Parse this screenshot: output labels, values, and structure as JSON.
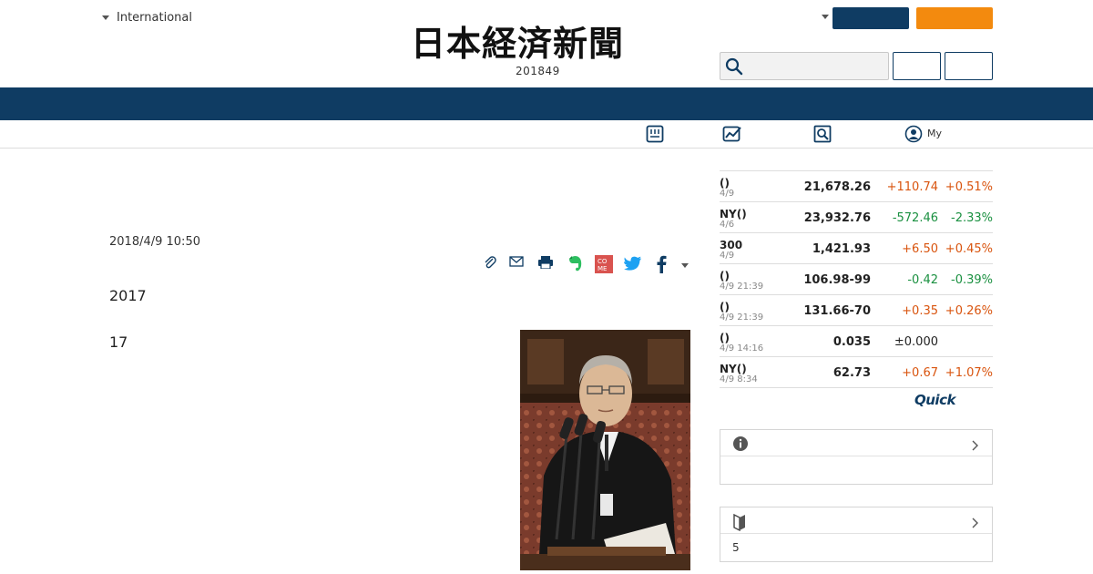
{
  "header": {
    "edition_label": "International",
    "logo_text": "日本経済新聞",
    "issue_number": "201849",
    "search_placeholder": ""
  },
  "subnav": {
    "my_label": "My"
  },
  "article": {
    "date": "2018/4/9 10:50",
    "paragraph_1": "2017",
    "paragraph_2": "17",
    "share_icons": [
      "clip-icon",
      "mail-icon",
      "print-icon",
      "evernote-icon",
      "comemo-icon",
      "twitter-icon",
      "facebook-icon",
      "more-icon"
    ]
  },
  "market": {
    "rows": [
      {
        "name": "()",
        "time": "4/9",
        "value": "21,678.26",
        "change": "+110.74",
        "pct": "+0.51%",
        "dir": "up"
      },
      {
        "name": "NY()",
        "time": "4/6",
        "value": "23,932.76",
        "change": "-572.46",
        "pct": "-2.33%",
        "dir": "down"
      },
      {
        "name": "300",
        "time": "4/9",
        "value": "1,421.93",
        "change": "+6.50",
        "pct": "+0.45%",
        "dir": "up"
      },
      {
        "name": "()",
        "time": "4/9 21:39",
        "value": "106.98-99",
        "change": "-0.42",
        "pct": "-0.39%",
        "dir": "down"
      },
      {
        "name": "()",
        "time": "4/9 21:39",
        "value": "131.66-70",
        "change": "+0.35",
        "pct": "+0.26%",
        "dir": "up"
      },
      {
        "name": "()",
        "time": "4/9 14:16",
        "value": "0.035",
        "change": "±0.000",
        "pct": "",
        "dir": "flat"
      },
      {
        "name": "NY()",
        "time": "4/9 8:34",
        "value": "62.73",
        "change": "+0.67",
        "pct": "+1.07%",
        "dir": "up"
      }
    ],
    "quick_label": "Quick"
  },
  "info_box": {
    "body": ""
  },
  "beginner_box": {
    "body": "5"
  },
  "colors": {
    "navy": "#0f3c63",
    "orange": "#f38a0e",
    "up": "#d9540e",
    "down": "#1a9040"
  }
}
